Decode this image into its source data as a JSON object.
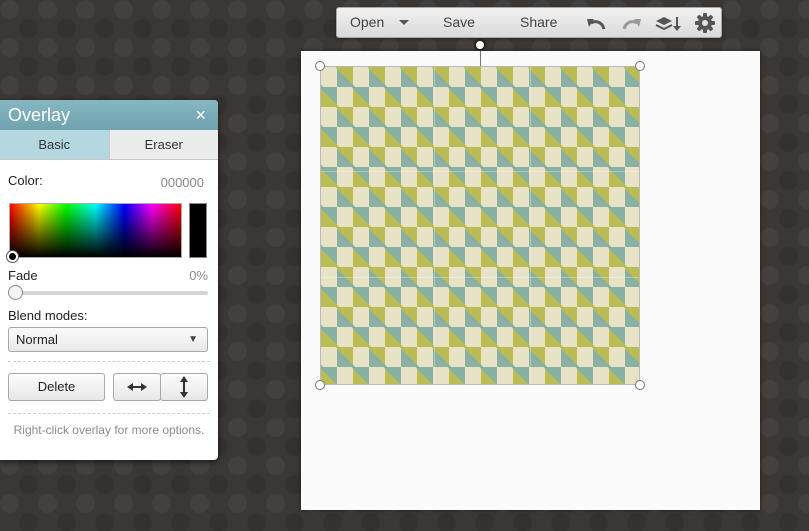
{
  "toolbar": {
    "open_label": "Open",
    "save_label": "Save",
    "share_label": "Share",
    "icons": [
      "undo-icon",
      "redo-icon",
      "layers-down-icon",
      "gear-icon"
    ]
  },
  "panel": {
    "title": "Overlay",
    "close_glyph": "×",
    "tabs": [
      {
        "label": "Basic",
        "active": true
      },
      {
        "label": "Eraser",
        "active": false
      }
    ],
    "color_label": "Color:",
    "color_value": "000000",
    "fade_label": "Fade",
    "fade_value": "0%",
    "fade_fraction": 0,
    "blend_label": "Blend modes:",
    "blend_selected": "Normal",
    "delete_label": "Delete",
    "hint": "Right-click overlay for more options."
  },
  "colors": {
    "panel_header": "#78abb6",
    "active_tab": "#b5d8e0",
    "selected_color": "#000000"
  }
}
